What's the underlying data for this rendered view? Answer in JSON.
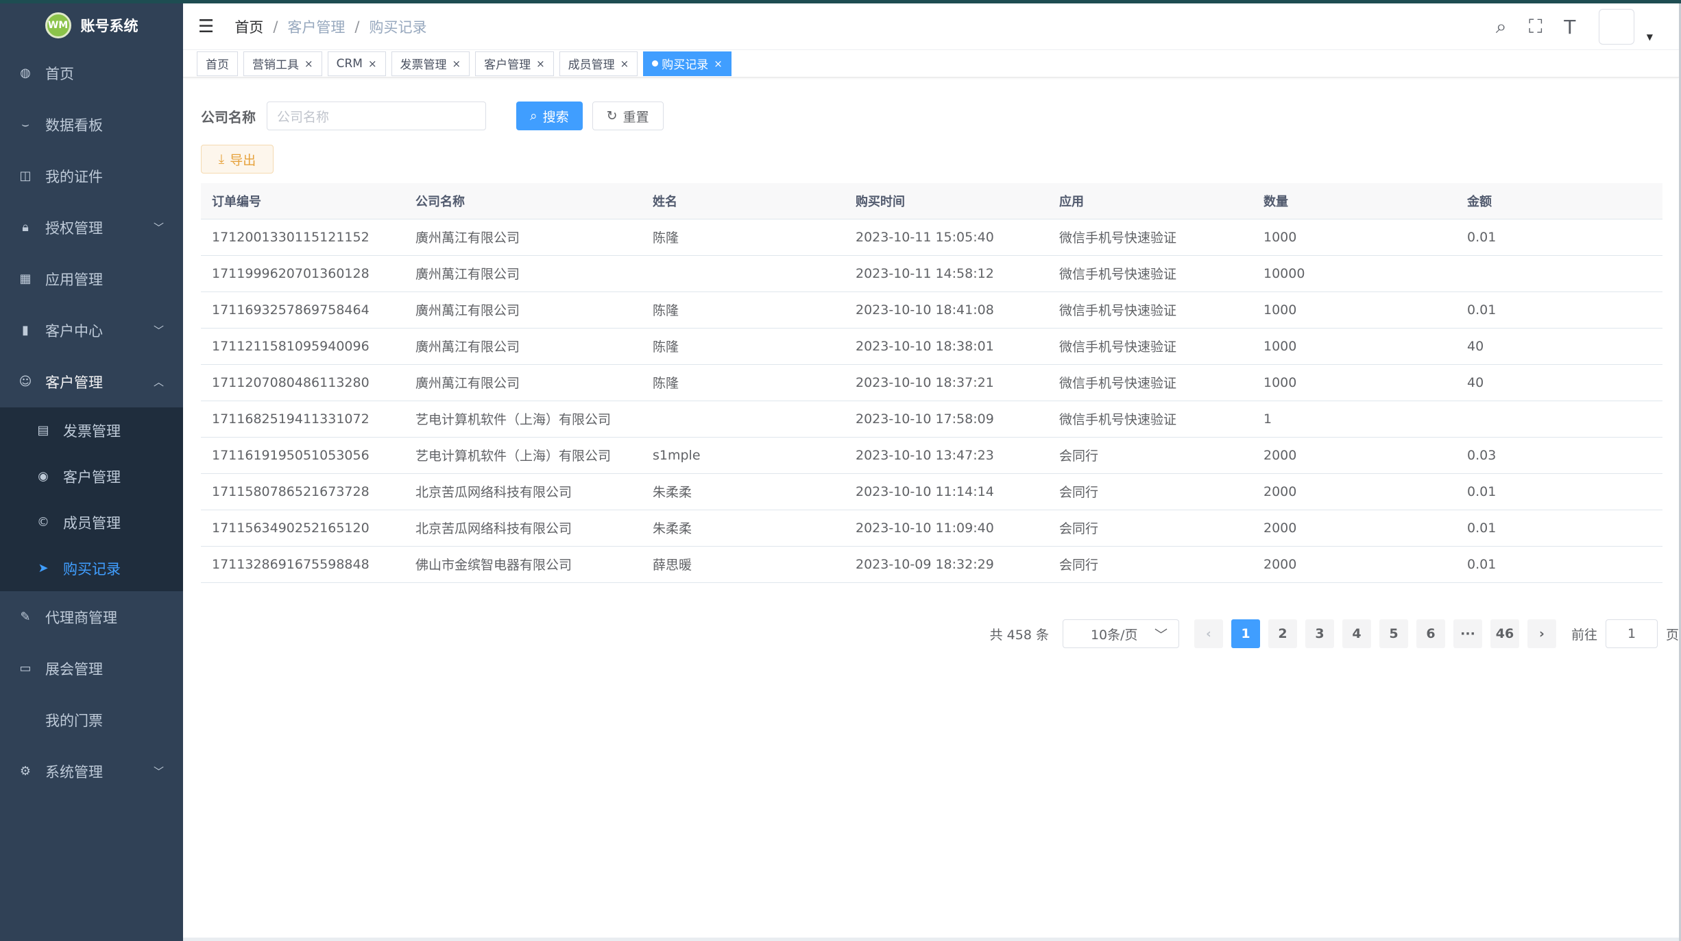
{
  "app": {
    "title": "账号系统",
    "logo_text": "WM"
  },
  "sidebar": {
    "items": [
      {
        "label": "首页",
        "icon": "dashboard-icon"
      },
      {
        "label": "数据看板",
        "icon": "eye-icon"
      },
      {
        "label": "我的证件",
        "icon": "book-icon"
      },
      {
        "label": "授权管理",
        "icon": "lock-icon"
      },
      {
        "label": "应用管理",
        "icon": "calendar-icon"
      },
      {
        "label": "客户中心",
        "icon": "chart-icon"
      },
      {
        "label": "客户管理",
        "icon": "user-icon"
      }
    ],
    "sub_items": [
      {
        "label": "发票管理"
      },
      {
        "label": "客户管理"
      },
      {
        "label": "成员管理"
      },
      {
        "label": "购买记录"
      }
    ],
    "items_after": [
      {
        "label": "代理商管理"
      },
      {
        "label": "展会管理"
      },
      {
        "label": "我的门票"
      },
      {
        "label": "系统管理"
      }
    ]
  },
  "breadcrumb": [
    "首页",
    "客户管理",
    "购买记录"
  ],
  "tags": [
    "首页",
    "营销工具",
    "CRM",
    "发票管理",
    "客户管理",
    "成员管理",
    "购买记录"
  ],
  "search": {
    "label": "公司名称",
    "placeholder": "公司名称",
    "search_button": "搜索",
    "reset_button": "重置",
    "export_button": "导出"
  },
  "table": {
    "headers": [
      "订单编号",
      "公司名称",
      "姓名",
      "购买时间",
      "应用",
      "数量",
      "金额"
    ],
    "rows": [
      [
        "1712001330115121152",
        "廣州萬江有限公司",
        "陈隆",
        "2023-10-11 15:05:40",
        "微信手机号快速验证",
        "1000",
        "0.01"
      ],
      [
        "1711999620701360128",
        "廣州萬江有限公司",
        "",
        "2023-10-11 14:58:12",
        "微信手机号快速验证",
        "10000",
        ""
      ],
      [
        "1711693257869758464",
        "廣州萬江有限公司",
        "陈隆",
        "2023-10-10 18:41:08",
        "微信手机号快速验证",
        "1000",
        "0.01"
      ],
      [
        "1711211581095940096",
        "廣州萬江有限公司",
        "陈隆",
        "2023-10-10 18:38:01",
        "微信手机号快速验证",
        "1000",
        "40"
      ],
      [
        "1711207080486113280",
        "廣州萬江有限公司",
        "陈隆",
        "2023-10-10 18:37:21",
        "微信手机号快速验证",
        "1000",
        "40"
      ],
      [
        "1711682519411331072",
        "艺电计算机软件（上海）有限公司",
        "",
        "2023-10-10 17:58:09",
        "微信手机号快速验证",
        "1",
        ""
      ],
      [
        "1711619195051053056",
        "艺电计算机软件（上海）有限公司",
        "s1mple",
        "2023-10-10 13:47:23",
        "会同行",
        "2000",
        "0.03"
      ],
      [
        "1711580786521673728",
        "北京苦瓜网络科技有限公司",
        "朱柔柔",
        "2023-10-10 11:14:14",
        "会同行",
        "2000",
        "0.01"
      ],
      [
        "1711563490252165120",
        "北京苦瓜网络科技有限公司",
        "朱柔柔",
        "2023-10-10 11:09:40",
        "会同行",
        "2000",
        "0.01"
      ],
      [
        "1711328691675598848",
        "佛山市金缤智电器有限公司",
        "薛思暖",
        "2023-10-09 18:32:29",
        "会同行",
        "2000",
        "0.01"
      ]
    ]
  },
  "pagination": {
    "total": "共 458 条",
    "page_size": "10条/页",
    "pages": [
      "1",
      "2",
      "3",
      "4",
      "5",
      "6",
      "···",
      "46"
    ],
    "current": "1",
    "goto_label": "前往",
    "goto_value": "1",
    "page_suffix": "页"
  }
}
